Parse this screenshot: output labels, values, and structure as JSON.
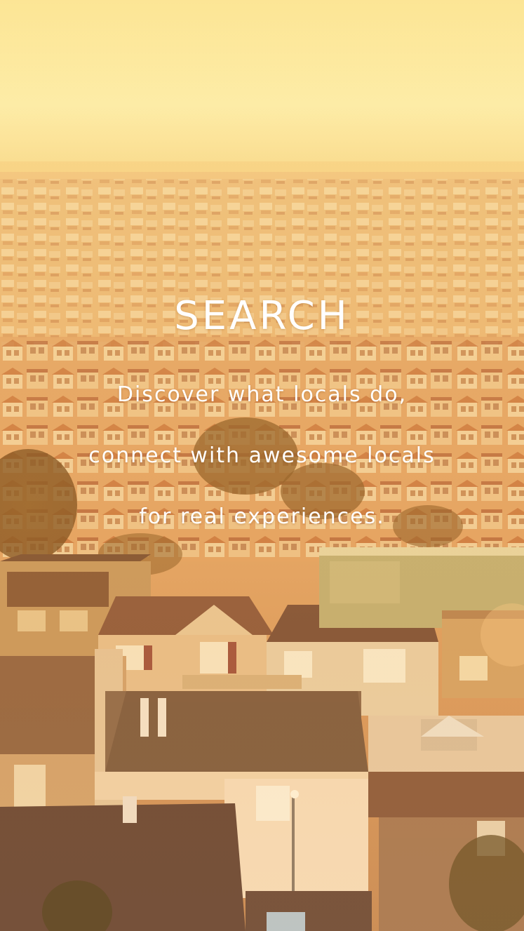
{
  "screen": {
    "title": "SEARCH",
    "subtitle_lines": [
      "Discover what locals do,",
      "connect with awesome locals",
      "for real experiences."
    ]
  },
  "colors": {
    "sky_top": "#fdeaa0",
    "haze": "#f6c46a",
    "rooftops": "#c7793a",
    "text": "#ffffff"
  }
}
